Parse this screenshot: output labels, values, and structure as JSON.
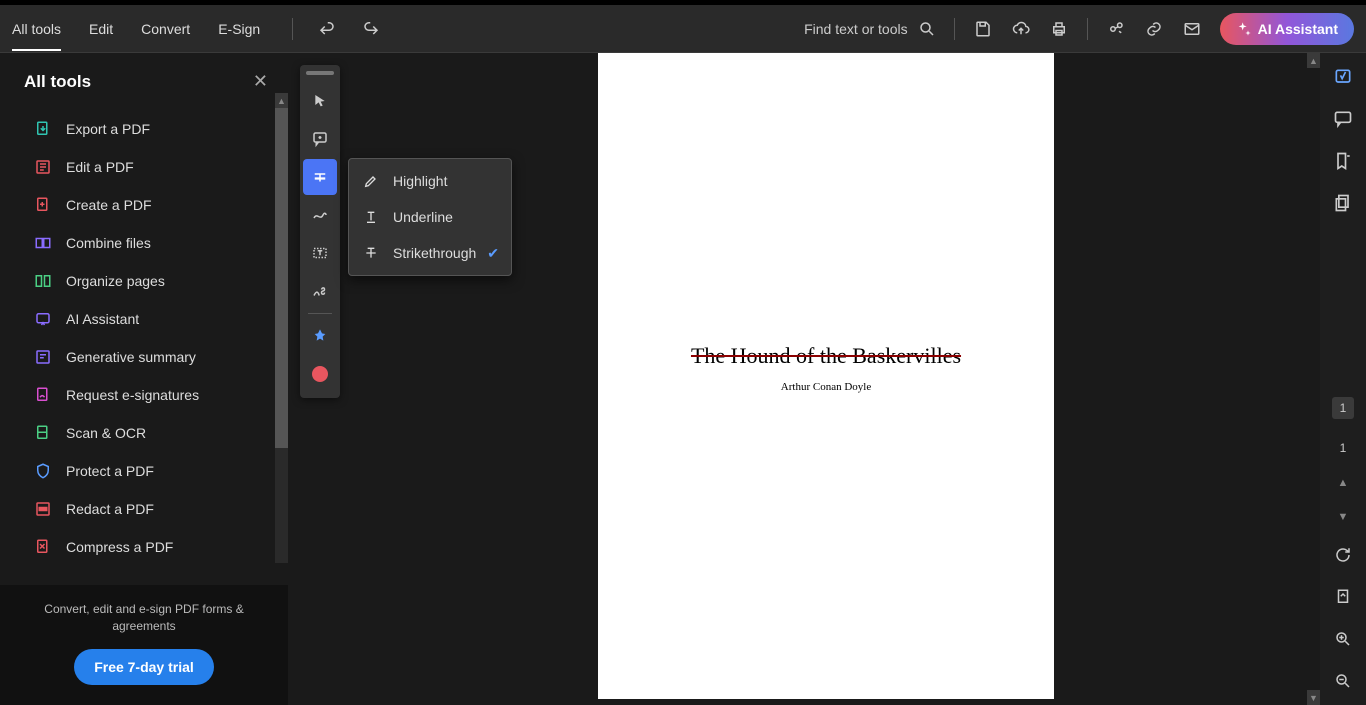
{
  "toolbar": {
    "menu": [
      "All tools",
      "Edit",
      "Convert",
      "E-Sign"
    ],
    "active_menu": 0,
    "search_placeholder": "Find text or tools",
    "ai_label": "AI Assistant"
  },
  "sidebar": {
    "title": "All tools",
    "items": [
      {
        "label": "Export a PDF",
        "color": "#30c5b2",
        "icon": "export"
      },
      {
        "label": "Edit a PDF",
        "color": "#e8565f",
        "icon": "edit"
      },
      {
        "label": "Create a PDF",
        "color": "#e8565f",
        "icon": "create"
      },
      {
        "label": "Combine files",
        "color": "#8a6cff",
        "icon": "combine"
      },
      {
        "label": "Organize pages",
        "color": "#4bd084",
        "icon": "organize"
      },
      {
        "label": "AI Assistant",
        "color": "#8a6cff",
        "icon": "ai"
      },
      {
        "label": "Generative summary",
        "color": "#8a6cff",
        "icon": "summary"
      },
      {
        "label": "Request e-signatures",
        "color": "#d94fd0",
        "icon": "esign"
      },
      {
        "label": "Scan & OCR",
        "color": "#4bd084",
        "icon": "scan"
      },
      {
        "label": "Protect a PDF",
        "color": "#5a9cff",
        "icon": "protect"
      },
      {
        "label": "Redact a PDF",
        "color": "#e8565f",
        "icon": "redact"
      },
      {
        "label": "Compress a PDF",
        "color": "#e8565f",
        "icon": "compress"
      }
    ],
    "footer_text": "Convert, edit and e-sign PDF forms & agreements",
    "trial_button": "Free 7-day trial"
  },
  "quickbar": {
    "items": [
      {
        "name": "select",
        "active": false
      },
      {
        "name": "comment",
        "active": false
      },
      {
        "name": "text-markup",
        "active": true
      },
      {
        "name": "draw",
        "active": false
      },
      {
        "name": "text-box",
        "active": false
      },
      {
        "name": "sign",
        "active": false
      }
    ]
  },
  "textmarkup_popup": {
    "items": [
      {
        "label": "Highlight",
        "icon": "highlight",
        "checked": false
      },
      {
        "label": "Underline",
        "icon": "underline",
        "checked": false
      },
      {
        "label": "Strikethrough",
        "icon": "strikethrough",
        "checked": true
      }
    ]
  },
  "document": {
    "title": "The Hound of the Baskervilles",
    "author": "Arthur Conan Doyle"
  },
  "right_rail": {
    "current_page": "1",
    "total_pages": "1"
  }
}
